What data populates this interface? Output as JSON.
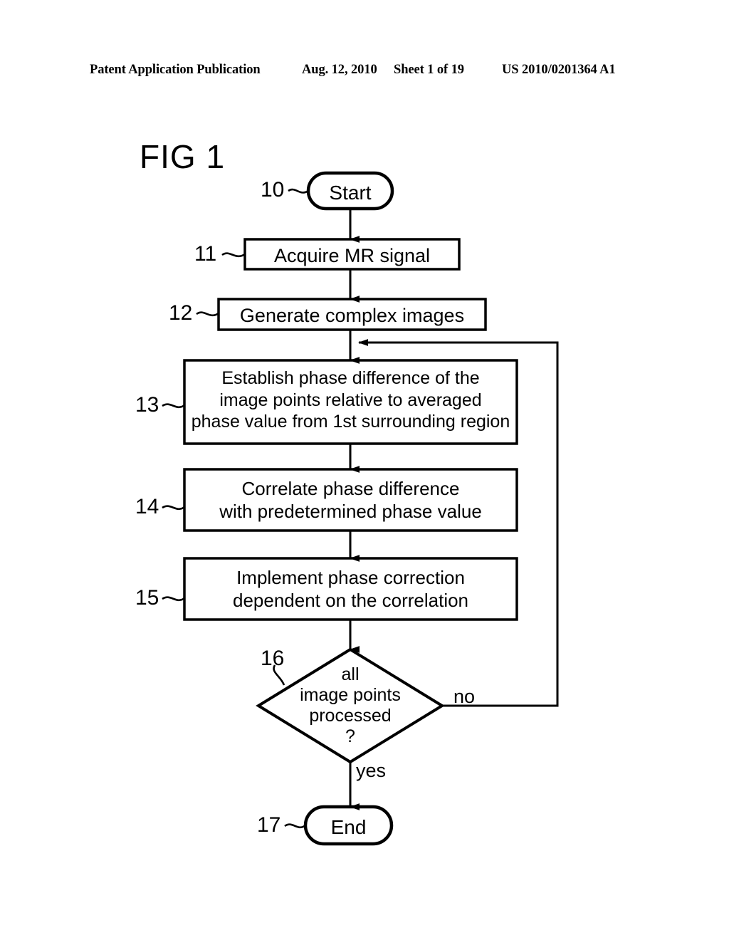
{
  "header": {
    "publication": "Patent Application Publication",
    "date": "Aug. 12, 2010",
    "sheet": "Sheet 1 of 19",
    "patent_number": "US 2010/0201364 A1"
  },
  "figure": {
    "title": "FIG 1",
    "nodes": [
      {
        "ref": "10",
        "shape": "terminal",
        "label": "Start"
      },
      {
        "ref": "11",
        "shape": "process",
        "label": "Acquire MR signal"
      },
      {
        "ref": "12",
        "shape": "process",
        "label": "Generate complex images"
      },
      {
        "ref": "13",
        "shape": "process",
        "label": "Establish phase difference of the\nimage points relative to averaged\nphase value from 1st surrounding region"
      },
      {
        "ref": "14",
        "shape": "process",
        "label": "Correlate phase difference\nwith predetermined phase value"
      },
      {
        "ref": "15",
        "shape": "process",
        "label": "Implement phase correction\ndependent on the correlation"
      },
      {
        "ref": "16",
        "shape": "decision",
        "label": "all\nimage points\nprocessed\n?"
      },
      {
        "ref": "17",
        "shape": "terminal",
        "label": "End"
      }
    ],
    "edge_labels": {
      "no": "no",
      "yes": "yes"
    },
    "colors": {
      "stroke": "#000000",
      "fill": "#ffffff"
    }
  }
}
